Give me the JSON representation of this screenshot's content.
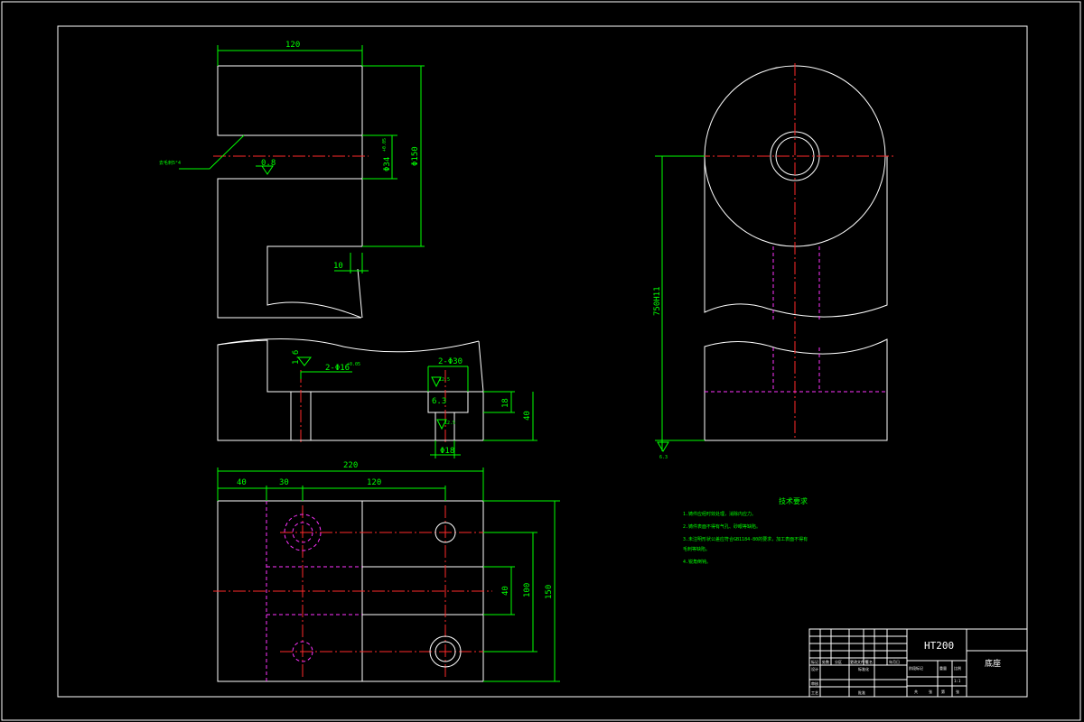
{
  "dimensions": {
    "top_width": "120",
    "top_height": "Φ150",
    "hole_dia": "Φ34",
    "hole_tol": "+0.05",
    "roughness_hole": "0.8",
    "leader_note": "去毛刺5°4",
    "step_10": "10",
    "rough_16": "1.6",
    "holes_2x16": "2-Φ16",
    "holes_2x16_tol": "+0.05",
    "holes_2x30": "2-Φ30",
    "r125_a": "12.5",
    "r63": "6.3",
    "r125_b": "12.5",
    "dim_18": "18",
    "dim_40": "40",
    "dia_18": "Φ18",
    "plan_220": "220",
    "plan_40": "40",
    "plan_30": "30",
    "plan_120": "120",
    "plan_v40": "40",
    "plan_v100": "100",
    "plan_v150": "150",
    "side_750": "750H11",
    "side_rough": "6.3"
  },
  "notes": {
    "title": "技术要求",
    "lines": [
      "1.铸件应经时效处理，消除内应力。",
      "2.铸件表面不得有气孔、砂眼等缺陷。",
      "3.未注明形状公差应符合GB1184-80的要求，加工表面不得有",
      "毛刺等缺陷。",
      "4.锐角倒钝。"
    ]
  },
  "title_block": {
    "material": "HT200",
    "part_name": "底座",
    "cells": [
      "标记",
      "处数",
      "分区",
      "更改文件号",
      "签名",
      "年月日",
      "设计",
      "标准化",
      "阶段标记",
      "重量",
      "比例",
      "审核",
      "工艺",
      "批准",
      "共",
      "张",
      "第",
      "张",
      "1:1"
    ]
  },
  "colors": {
    "background": "#000000",
    "outline": "#ffffff",
    "dimension": "#00ff00",
    "centerline": "#ff2a2a",
    "hidden": "#ff33ff",
    "hatch": "#00b3b3"
  }
}
